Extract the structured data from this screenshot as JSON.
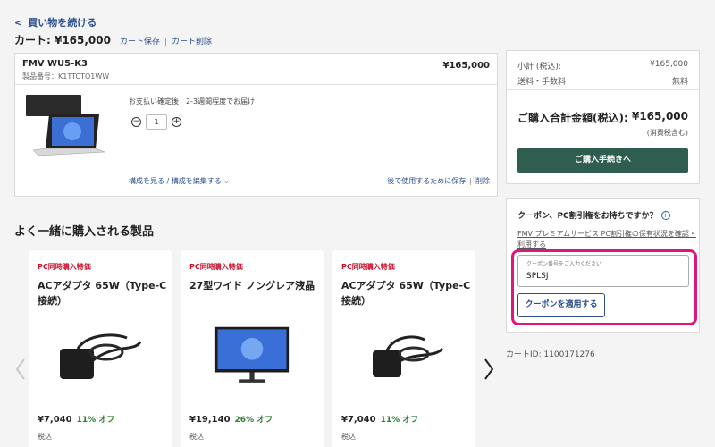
{
  "nav": {
    "continue_label": "買い物を続ける"
  },
  "cart": {
    "title": "カート: ¥165,000",
    "save_label": "カート保存",
    "delete_label": "カート削除",
    "cart_id": "カートID: 1100171276"
  },
  "item": {
    "name": "FMV WU5-K3",
    "code": "製品番号：K1TTCTO1WW",
    "price": "¥165,000",
    "shipping_note": "お支払い確定後　2-3週間程度でお届け",
    "quantity": "1",
    "config_link": "構成を見る / 構成を編集する",
    "save_later": "後で使用するために保存",
    "remove": "削除"
  },
  "summary": {
    "subtotal_label": "小計 (税込):",
    "subtotal_value": "¥165,000",
    "shipping_label": "送料・手数料",
    "shipping_value": "無料",
    "grand_label": "ご購入合計金額(税込):",
    "grand_value": "¥165,000",
    "tax_note": "(消費税含む)",
    "checkout_label": "ご購入手続きへ"
  },
  "coupon": {
    "title": "クーポン、PC割引権をお持ちですか？",
    "link_text": "FMV プレミアムサービス PC割引権の保有状況を確認・利用する",
    "placeholder": "クーポン番号をご入力ください",
    "value": "SPLSJ",
    "apply_label": "クーポンを適用する"
  },
  "recommend": {
    "title": "よく一緒に購入される製品",
    "products": [
      {
        "badge": "PC同時購入特価",
        "name": "ACアダプタ 65W（Type-C接続）",
        "price": "¥7,040",
        "discount": "11% オフ",
        "tax": "税込"
      },
      {
        "badge": "PC同時購入特価",
        "name": "27型ワイド ノングレア液晶",
        "price": "¥19,140",
        "discount": "26% オフ",
        "tax": "税込"
      },
      {
        "badge": "PC同時購入特価",
        "name": "ACアダプタ 65W（Type-C接続）",
        "price": "¥7,040",
        "discount": "11% オフ",
        "tax": "税込"
      }
    ]
  },
  "colors": {
    "accent": "#2c4f8c",
    "checkout": "#2f5d4f",
    "highlight": "#e0147a",
    "badge": "#c8102e",
    "discount": "#2e7d32"
  }
}
